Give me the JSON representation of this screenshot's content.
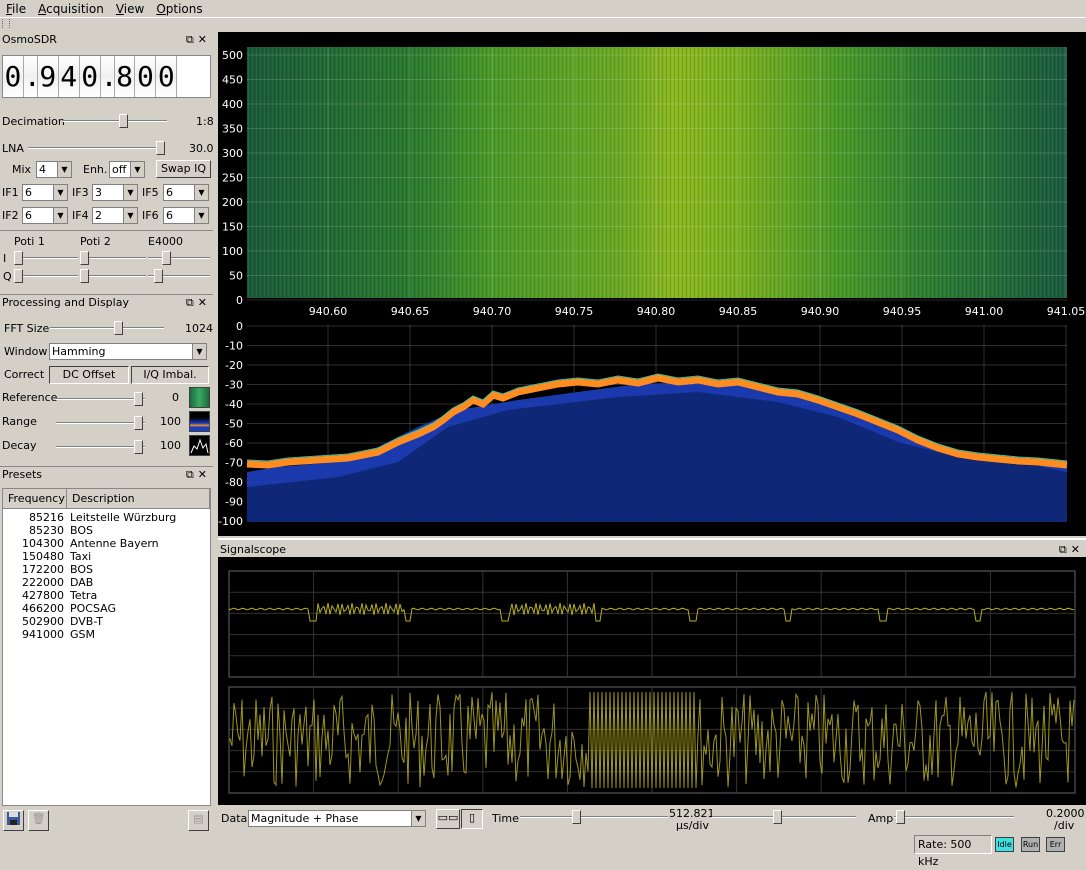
{
  "menu": [
    "File",
    "Acquisition",
    "View",
    "Options"
  ],
  "osmosdr": {
    "title": "OsmoSDR",
    "freq_digits": [
      "0",
      ".",
      "9",
      "4",
      "0",
      ".",
      "8",
      "0",
      "0"
    ],
    "decimation_label": "Decimation",
    "decimation_value": "1:8",
    "lna_label": "LNA",
    "lna_value": "30.0",
    "mix_label": "Mix",
    "mix_value": "4",
    "enh_label": "Enh.",
    "enh_value": "off",
    "swap_iq": "Swap IQ",
    "if": [
      {
        "label": "IF1",
        "value": "6"
      },
      {
        "label": "IF3",
        "value": "3"
      },
      {
        "label": "IF5",
        "value": "6"
      },
      {
        "label": "IF2",
        "value": "6"
      },
      {
        "label": "IF4",
        "value": "2"
      },
      {
        "label": "IF6",
        "value": "6"
      }
    ],
    "poti1": "Poti 1",
    "poti2": "Poti 2",
    "e4000": "E4000",
    "i_label": "I",
    "q_label": "Q"
  },
  "processing": {
    "title": "Processing and Display",
    "fft_label": "FFT Size",
    "fft_value": "1024",
    "window_label": "Window",
    "window_value": "Hamming",
    "correct_label": "Correct",
    "dc_offset": "DC Offset",
    "iq_imbal": "I/Q Imbal.",
    "reference_label": "Reference",
    "reference_value": "0",
    "range_label": "Range",
    "range_value": "100",
    "decay_label": "Decay",
    "decay_value": "100"
  },
  "presets": {
    "title": "Presets",
    "col_frequency": "Frequency",
    "col_description": "Description",
    "rows": [
      {
        "freq": "85216",
        "desc": "Leitstelle Würzburg"
      },
      {
        "freq": "85230",
        "desc": "BOS"
      },
      {
        "freq": "104300",
        "desc": "Antenne Bayern"
      },
      {
        "freq": "150480",
        "desc": "Taxi"
      },
      {
        "freq": "172200",
        "desc": "BOS"
      },
      {
        "freq": "222000",
        "desc": "DAB"
      },
      {
        "freq": "427800",
        "desc": "Tetra"
      },
      {
        "freq": "466200",
        "desc": "POCSAG"
      },
      {
        "freq": "502900",
        "desc": "DVB-T"
      },
      {
        "freq": "941000",
        "desc": "GSM"
      }
    ]
  },
  "waterfall": {
    "y_ticks": [
      "500",
      "450",
      "400",
      "350",
      "300",
      "250",
      "200",
      "150",
      "100",
      "50",
      "0"
    ],
    "x_ticks": [
      "940.60",
      "940.65",
      "940.70",
      "940.75",
      "940.80",
      "940.85",
      "940.90",
      "940.95",
      "941.00",
      "941.05"
    ]
  },
  "spectrum": {
    "y_ticks": [
      "0",
      "-10",
      "-20",
      "-30",
      "-40",
      "-50",
      "-60",
      "-70",
      "-80",
      "-90",
      "-100"
    ]
  },
  "signalscope": {
    "title": "Signalscope",
    "data_label": "Data",
    "data_value": "Magnitude + Phase",
    "time_label": "Time",
    "time_value": "512.821",
    "time_unit": "µs/div",
    "amp_label": "Amp",
    "amp_value": "0.2000",
    "amp_unit": "/div"
  },
  "status": {
    "rate": "Rate: 500 kHz",
    "idle": "Idle",
    "run": "Run",
    "err": "Err"
  },
  "colors": {
    "waterfall_green": "#7fb020",
    "spectrum_blue": "#1840c0",
    "spectrum_orange": "#ff8c20",
    "scope_yellow": "#b8b020",
    "idle_cyan": "#40e0e0"
  }
}
